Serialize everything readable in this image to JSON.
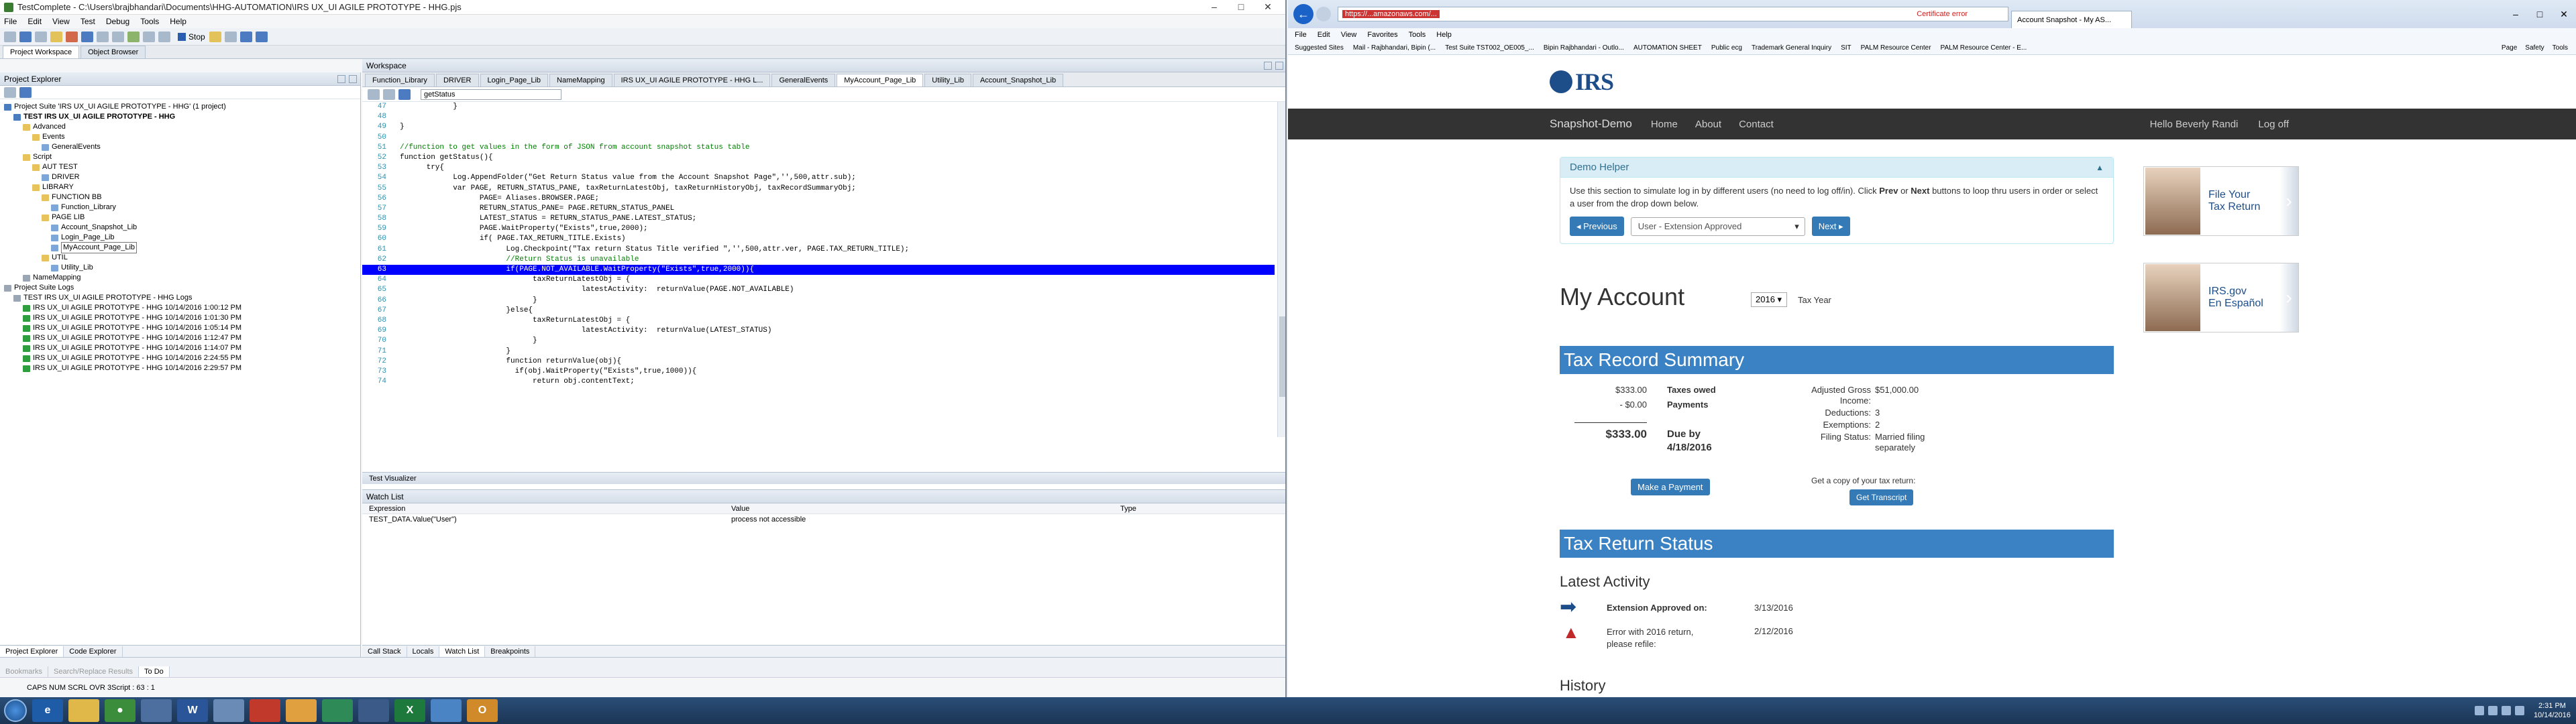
{
  "tc": {
    "title": "TestComplete - C:\\Users\\brajbhandari\\Documents\\HHG-AUTOMATION\\IRS UX_UI AGILE PROTOTYPE - HHG.pjs",
    "menu": [
      "File",
      "Edit",
      "View",
      "Test",
      "Debug",
      "Tools",
      "Help"
    ],
    "stop_label": "Stop",
    "workspace_tabs": [
      "Project Workspace",
      "Object Browser"
    ],
    "explorer_title": "Project Explorer",
    "tree": [
      {
        "t": "Project Suite 'IRS UX_UI AGILE PROTOTYPE - HHG' (1 project)",
        "ic": "p",
        "lvl": 0
      },
      {
        "t": "TEST IRS UX_UI AGILE PROTOTYPE - HHG",
        "ic": "p",
        "lvl": 1,
        "b": true
      },
      {
        "t": "Advanced",
        "ic": "f",
        "lvl": 2
      },
      {
        "t": "Events",
        "ic": "f",
        "lvl": 3
      },
      {
        "t": "GeneralEvents",
        "ic": "s",
        "lvl": 4
      },
      {
        "t": "Script",
        "ic": "f",
        "lvl": 2
      },
      {
        "t": "AUT TEST",
        "ic": "f",
        "lvl": 3
      },
      {
        "t": "DRIVER",
        "ic": "s",
        "lvl": 4
      },
      {
        "t": "LIBRARY",
        "ic": "f",
        "lvl": 3
      },
      {
        "t": "FUNCTION BB",
        "ic": "f",
        "lvl": 4
      },
      {
        "t": "Function_Library",
        "ic": "s",
        "lvl": 5
      },
      {
        "t": "PAGE LIB",
        "ic": "f",
        "lvl": 4
      },
      {
        "t": "Account_Snapshot_Lib",
        "ic": "s",
        "lvl": 5
      },
      {
        "t": "Login_Page_Lib",
        "ic": "s",
        "lvl": 5
      },
      {
        "t": "MyAccount_Page_Lib",
        "ic": "s",
        "lvl": 5,
        "sel": true
      },
      {
        "t": "UTIL",
        "ic": "f",
        "lvl": 4
      },
      {
        "t": "Utility_Lib",
        "ic": "s",
        "lvl": 5
      },
      {
        "t": "NameMapping",
        "ic": "l",
        "lvl": 2
      },
      {
        "t": "Project Suite Logs",
        "ic": "l",
        "lvl": 0
      },
      {
        "t": "TEST IRS UX_UI AGILE PROTOTYPE - HHG Logs",
        "ic": "l",
        "lvl": 1
      },
      {
        "t": "IRS UX_UI AGILE PROTOTYPE - HHG 10/14/2016 1:00:12 PM",
        "ic": "ok",
        "lvl": 2
      },
      {
        "t": "IRS UX_UI AGILE PROTOTYPE - HHG 10/14/2016 1:01:30 PM",
        "ic": "ok",
        "lvl": 2
      },
      {
        "t": "IRS UX_UI AGILE PROTOTYPE - HHG 10/14/2016 1:05:14 PM",
        "ic": "ok",
        "lvl": 2
      },
      {
        "t": "IRS UX_UI AGILE PROTOTYPE - HHG 10/14/2016 1:12:47 PM",
        "ic": "ok",
        "lvl": 2
      },
      {
        "t": "IRS UX_UI AGILE PROTOTYPE - HHG 10/14/2016 1:14:07 PM",
        "ic": "ok",
        "lvl": 2
      },
      {
        "t": "IRS UX_UI AGILE PROTOTYPE - HHG 10/14/2016 2:24:55 PM",
        "ic": "ok",
        "lvl": 2
      },
      {
        "t": "IRS UX_UI AGILE PROTOTYPE - HHG 10/14/2016 2:29:57 PM",
        "ic": "ok",
        "lvl": 2
      }
    ],
    "explorer_bottom_tabs": [
      "Project Explorer",
      "Code Explorer"
    ],
    "ws_title": "Workspace",
    "ws_tabs": [
      "Function_Library",
      "DRIVER",
      "Login_Page_Lib",
      "NameMapping",
      "IRS UX_UI AGILE PROTOTYPE - HHG L...",
      "GeneralEvents",
      "MyAccount_Page_Lib",
      "Utility_Lib",
      "Account_Snapshot_Lib"
    ],
    "ws_active_tab": 6,
    "routine": "getStatus",
    "code": [
      {
        "n": "47",
        "s": "            }"
      },
      {
        "n": "48",
        "s": ""
      },
      {
        "n": "49",
        "s": "}"
      },
      {
        "n": "50",
        "s": ""
      },
      {
        "n": "51",
        "s": "//function to get values in the form of JSON from account snapshot status table",
        "c": "cm"
      },
      {
        "n": "52",
        "s": "function getStatus(){"
      },
      {
        "n": "53",
        "s": "      try{"
      },
      {
        "n": "54",
        "s": "            Log.AppendFolder(\"Get Return Status value from the Account Snapshot Page\",'',500,attr.sub);"
      },
      {
        "n": "55",
        "s": "            var PAGE, RETURN_STATUS_PANE, taxReturnLatestObj, taxReturnHistoryObj, taxRecordSummaryObj;"
      },
      {
        "n": "56",
        "s": "                  PAGE= Aliases.BROWSER.PAGE;"
      },
      {
        "n": "57",
        "s": "                  RETURN_STATUS_PANE= PAGE.RETURN_STATUS_PANEL"
      },
      {
        "n": "58",
        "s": "                  LATEST_STATUS = RETURN_STATUS_PANE.LATEST_STATUS;"
      },
      {
        "n": "59",
        "s": "                  PAGE.WaitProperty(\"Exists\",true,2000);"
      },
      {
        "n": "60",
        "s": "                  if( PAGE.TAX_RETURN_TITLE.Exists)"
      },
      {
        "n": "61",
        "s": "                        Log.Checkpoint(\"Tax return Status Title verified \",'',500,attr.ver, PAGE.TAX_RETURN_TITLE);"
      },
      {
        "n": "62",
        "s": "                        //Return Status is unavailable",
        "c": "cm"
      },
      {
        "n": "63",
        "s": "                        if(PAGE.NOT_AVAILABLE.WaitProperty(\"Exists\",true,2000)){",
        "hl": true
      },
      {
        "n": "64",
        "s": "                              taxReturnLatestObj = {"
      },
      {
        "n": "65",
        "s": "                                         latestActivity:  returnValue(PAGE.NOT_AVAILABLE)"
      },
      {
        "n": "66",
        "s": "                              }"
      },
      {
        "n": "67",
        "s": "                        }else{"
      },
      {
        "n": "68",
        "s": "                              taxReturnLatestObj = {"
      },
      {
        "n": "69",
        "s": "                                         latestActivity:  returnValue(LATEST_STATUS)"
      },
      {
        "n": "70",
        "s": "                              }"
      },
      {
        "n": "71",
        "s": "                        }"
      },
      {
        "n": "72",
        "s": "                        function returnValue(obj){"
      },
      {
        "n": "73",
        "s": "                          if(obj.WaitProperty(\"Exists\",true,1000)){"
      },
      {
        "n": "74",
        "s": "                              return obj.contentText;"
      }
    ],
    "visualizer_title": "Test Visualizer",
    "watch_title": "Watch List",
    "watch_headers": [
      "Expression",
      "Value",
      "Type"
    ],
    "watch_rows": [
      {
        "expr": "TEST_DATA.Value(\"User\")",
        "value": "process not accessible",
        "type": ""
      }
    ],
    "ws_bottom_tabs": [
      "Call Stack",
      "Locals",
      "Watch List",
      "Breakpoints"
    ],
    "main_bottom_tabs": [
      "Bookmarks",
      "Search/Replace Results",
      "To Do"
    ],
    "status": "CAPS NUM SCRL OVR    3Script : 63 : 1"
  },
  "browser": {
    "url": "https://...amazonaws.com/...",
    "cert_error": "Certificate error",
    "tab_title": "Account Snapshot - My AS...",
    "menu": [
      "File",
      "Edit",
      "View",
      "Favorites",
      "Tools",
      "Help"
    ],
    "favorites": [
      "Suggested Sites",
      "Mail - Rajbhandari, Bipin (...",
      "Test Suite TST002_OE005_...",
      "Bipin Rajbhandari - Outlo...",
      "AUTOMATION SHEET",
      "Public ecg",
      "Trademark General Inquiry",
      "SIT",
      "PALM Resource Center",
      "PALM Resource Center - E..."
    ],
    "tools": [
      "Page",
      "Safety",
      "Tools"
    ],
    "logo": "IRS",
    "nav": {
      "brand": "Snapshot-Demo",
      "links": [
        "Home",
        "About",
        "Contact"
      ],
      "user": "Hello Beverly Randi",
      "logoff": "Log off"
    },
    "demo": {
      "title": "Demo Helper",
      "text_a": "Use this section to simulate log in by different users (no need to log off/in). Click ",
      "prev_word": "Prev",
      "text_b": " or ",
      "next_word": "Next",
      "text_c": " buttons to loop thru users in order or select a user from the drop down below.",
      "prev_btn": "Previous",
      "select": "User - Extension Approved",
      "next_btn": "Next"
    },
    "ads": [
      {
        "label1": "File Your",
        "label2": "Tax Return"
      },
      {
        "label1": "IRS.gov",
        "label2": "En Español"
      }
    ],
    "my_account": "My Account",
    "year": "2016",
    "year_label": "Tax Year",
    "tax_record_title": "Tax Record Summary",
    "taxes_owed_amt": "$333.00",
    "taxes_owed_lbl": "Taxes owed",
    "payments_amt": "- $0.00",
    "payments_lbl": "Payments",
    "total_amt": "$333.00",
    "due_by": "Due by",
    "due_date": "4/18/2016",
    "make_payment": "Make a Payment",
    "details": [
      {
        "k": "Adjusted Gross Income:",
        "v": "$51,000.00"
      },
      {
        "k": "Deductions:",
        "v": "3"
      },
      {
        "k": "Exemptions:",
        "v": "2"
      },
      {
        "k": "Filing Status:",
        "v": "Married filing separately"
      }
    ],
    "transcript_text": "Get a copy of your tax return:",
    "transcript_btn": "Get Transcript",
    "return_status_title": "Tax Return Status",
    "latest_title": "Latest Activity",
    "activity": [
      {
        "txt": "Extension Approved on:",
        "date": "3/13/2016",
        "bold": true
      },
      {
        "txt": "Error with 2016 return, please refile:",
        "date": "2/12/2016",
        "bold": false
      }
    ],
    "history": "History"
  },
  "taskbar": {
    "time": "2:31 PM",
    "date": "10/14/2016"
  }
}
